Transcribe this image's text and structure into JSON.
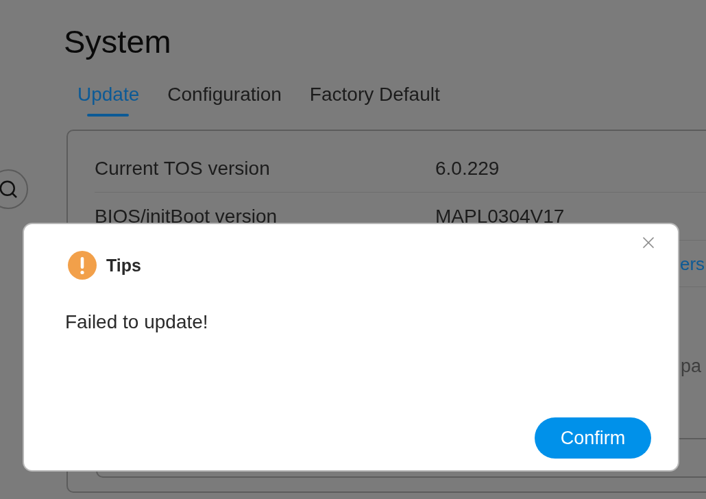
{
  "page_title": "System",
  "tabs": [
    {
      "label": "Update",
      "selected": true
    },
    {
      "label": "Configuration",
      "selected": false
    },
    {
      "label": "Factory Default",
      "selected": false
    }
  ],
  "info_rows": [
    {
      "label": "Current TOS version",
      "value": "6.0.229"
    },
    {
      "label": "BIOS/initBoot version",
      "value": "MAPL0304V17"
    }
  ],
  "hidden_rows": [
    {
      "kind": "link",
      "text": "ers"
    },
    {
      "kind": "text",
      "text": "pa"
    }
  ],
  "dialog": {
    "title": "Tips",
    "message": "Failed to update!",
    "confirm_label": "Confirm"
  }
}
